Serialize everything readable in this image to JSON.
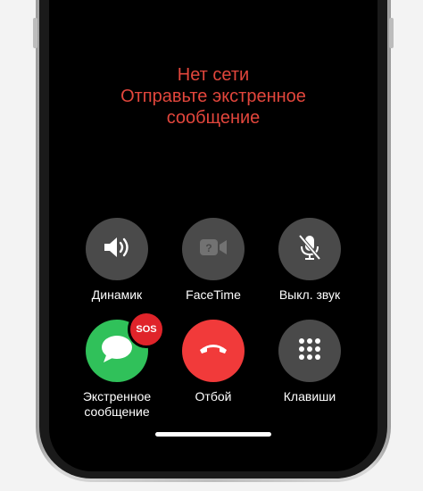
{
  "status": {
    "line1": "Нет сети",
    "line2": "Отправьте экстренное",
    "line3": "сообщение",
    "color": "#e2463c"
  },
  "controls": {
    "speaker": {
      "label": "Динамик",
      "icon": "speaker-icon"
    },
    "facetime": {
      "label": "FaceTime",
      "icon": "facetime-icon"
    },
    "mute": {
      "label": "Выкл. звук",
      "icon": "mic-off-icon"
    },
    "emergency": {
      "label_line1": "Экстренное",
      "label_line2": "сообщение",
      "badge": "SOS",
      "icon": "message-bubble-icon"
    },
    "end_call": {
      "label": "Отбой",
      "icon": "end-call-icon"
    },
    "keypad": {
      "label": "Клавиши",
      "icon": "keypad-icon"
    }
  },
  "colors": {
    "button_bg": "#4a4a4a",
    "emergency_bg": "#30c15a",
    "end_call_bg": "#f13a3a",
    "sos_badge_bg": "#e0242a"
  }
}
